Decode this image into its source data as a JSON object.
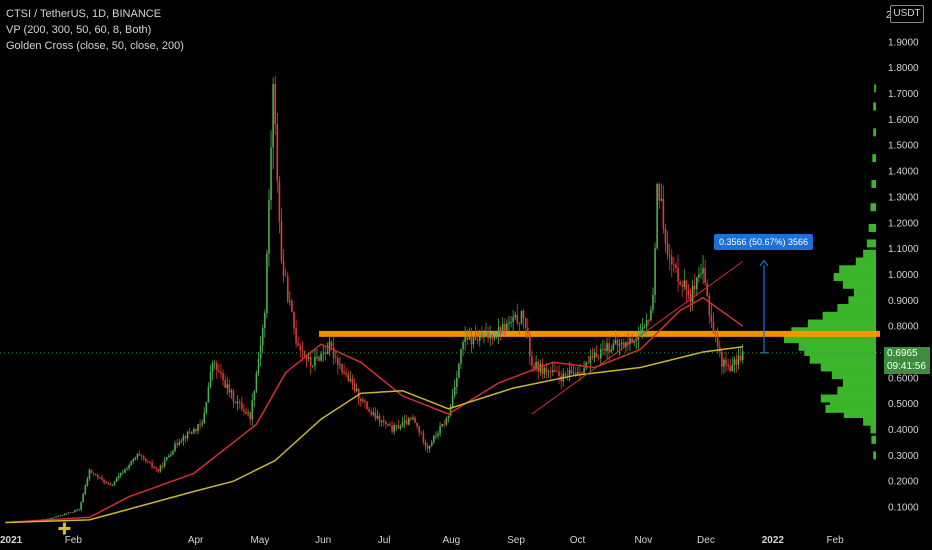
{
  "legend": {
    "title": "CTSI / TetherUS, 1D, BINANCE",
    "vp": "VP (200, 300, 50, 60, 8, Both)",
    "golden_cross": "Golden Cross (close, 50, close, 200)"
  },
  "currency_label": "USDT",
  "scale_top_label": "2",
  "current_price": "0.6965",
  "countdown": "09:41:56",
  "measure_label": "0.3566 (50.67%) 3566",
  "colors": {
    "background": "#000000",
    "candle_up": "#4caf50",
    "candle_down": "#e53935",
    "ma50": "#d32f2f",
    "ma200": "#c8b830",
    "resistance": "#ff9800",
    "volume_profile": "#3bb52b",
    "measure": "#1e6fd9"
  },
  "chart_data": {
    "type": "candlestick",
    "title": "CTSI / TetherUS, 1D, BINANCE",
    "xlabel": "",
    "ylabel": "",
    "y_axis": {
      "ticks": [
        "0.1000",
        "0.2000",
        "0.3000",
        "0.4000",
        "0.5000",
        "0.6000",
        "0.7000",
        "0.8000",
        "0.9000",
        "1.0000",
        "1.1000",
        "1.2000",
        "1.3000",
        "1.4000",
        "1.5000",
        "1.6000",
        "1.7000",
        "1.8000",
        "1.9000"
      ],
      "ylim": [
        0.04,
        2.0
      ],
      "unit": "USDT"
    },
    "x_axis": {
      "ticks": [
        "2021",
        "Feb",
        "Apr",
        "May",
        "Jun",
        "Jul",
        "Aug",
        "Sep",
        "Oct",
        "Nov",
        "Dec",
        "2022",
        "Feb"
      ],
      "bold_ticks": [
        "2021",
        "2022"
      ]
    },
    "price_path": [
      [
        "2021-01-01",
        0.04
      ],
      [
        "2021-01-20",
        0.05
      ],
      [
        "2021-02-05",
        0.09
      ],
      [
        "2021-02-10",
        0.24
      ],
      [
        "2021-02-20",
        0.18
      ],
      [
        "2021-03-05",
        0.3
      ],
      [
        "2021-03-15",
        0.24
      ],
      [
        "2021-03-25",
        0.36
      ],
      [
        "2021-04-05",
        0.42
      ],
      [
        "2021-04-10",
        0.66
      ],
      [
        "2021-04-20",
        0.52
      ],
      [
        "2021-04-28",
        0.45
      ],
      [
        "2021-05-05",
        0.85
      ],
      [
        "2021-05-09",
        1.72
      ],
      [
        "2021-05-13",
        1.05
      ],
      [
        "2021-05-20",
        0.75
      ],
      [
        "2021-05-27",
        0.65
      ],
      [
        "2021-06-05",
        0.72
      ],
      [
        "2021-06-15",
        0.58
      ],
      [
        "2021-06-25",
        0.46
      ],
      [
        "2021-07-05",
        0.4
      ],
      [
        "2021-07-15",
        0.44
      ],
      [
        "2021-07-22",
        0.33
      ],
      [
        "2021-08-01",
        0.45
      ],
      [
        "2021-08-08",
        0.74
      ],
      [
        "2021-08-20",
        0.76
      ],
      [
        "2021-09-06",
        0.84
      ],
      [
        "2021-09-10",
        0.65
      ],
      [
        "2021-09-25",
        0.6
      ],
      [
        "2021-10-05",
        0.64
      ],
      [
        "2021-10-15",
        0.72
      ],
      [
        "2021-10-25",
        0.73
      ],
      [
        "2021-11-03",
        0.78
      ],
      [
        "2021-11-07",
        0.9
      ],
      [
        "2021-11-09",
        1.36
      ],
      [
        "2021-11-15",
        1.05
      ],
      [
        "2021-11-25",
        0.92
      ],
      [
        "2021-12-01",
        1.0
      ],
      [
        "2021-12-05",
        0.82
      ],
      [
        "2021-12-10",
        0.66
      ],
      [
        "2021-12-15",
        0.64
      ],
      [
        "2021-12-20",
        0.7
      ]
    ],
    "series": [
      {
        "name": "",
        "type": "line",
        "values": [
          [
            "2021-01-01",
            0.04
          ],
          [
            "2021-02-10",
            0.06
          ],
          [
            "2021-03-01",
            0.14
          ],
          [
            "2021-04-01",
            0.23
          ],
          [
            "2021-05-01",
            0.42
          ],
          [
            "2021-05-15",
            0.62
          ],
          [
            "2021-06-01",
            0.73
          ],
          [
            "2021-06-20",
            0.66
          ],
          [
            "2021-07-10",
            0.53
          ],
          [
            "2021-08-01",
            0.46
          ],
          [
            "2021-08-25",
            0.58
          ],
          [
            "2021-09-20",
            0.66
          ],
          [
            "2021-10-10",
            0.64
          ],
          [
            "2021-11-01",
            0.71
          ],
          [
            "2021-11-20",
            0.86
          ],
          [
            "2021-12-01",
            0.91
          ],
          [
            "2021-12-20",
            0.8
          ]
        ]
      },
      {
        "name": "",
        "type": "line",
        "values": [
          [
            "2021-01-01",
            0.04
          ],
          [
            "2021-02-10",
            0.05
          ],
          [
            "2021-04-01",
            0.16
          ],
          [
            "2021-04-20",
            0.2
          ],
          [
            "2021-05-10",
            0.28
          ],
          [
            "2021-06-01",
            0.44
          ],
          [
            "2021-06-20",
            0.54
          ],
          [
            "2021-07-10",
            0.55
          ],
          [
            "2021-08-01",
            0.48
          ],
          [
            "2021-09-01",
            0.56
          ],
          [
            "2021-10-01",
            0.61
          ],
          [
            "2021-11-01",
            0.64
          ],
          [
            "2021-12-01",
            0.7
          ],
          [
            "2021-12-20",
            0.72
          ]
        ]
      }
    ],
    "annotations": [
      {
        "type": "horizontal_zone",
        "y": 0.77,
        "from": "2021-05-31",
        "to": "2022-03-31"
      },
      {
        "type": "trendline",
        "from": [
          "2021-09-10",
          0.46
        ],
        "to": [
          "2021-12-20",
          1.05
        ]
      },
      {
        "type": "measure",
        "from_y": 0.6965,
        "to_y": 1.0531,
        "text": "0.3566 (50.67%) 3566"
      },
      {
        "type": "marker",
        "label": "golden-cross",
        "at": [
          "2021-01-29",
          0.04
        ]
      }
    ],
    "volume_profile": [
      [
        0.3,
        0.03
      ],
      [
        0.36,
        0.05
      ],
      [
        0.4,
        0.06
      ],
      [
        0.43,
        0.14
      ],
      [
        0.46,
        0.35
      ],
      [
        0.48,
        0.55
      ],
      [
        0.5,
        0.5
      ],
      [
        0.52,
        0.6
      ],
      [
        0.55,
        0.42
      ],
      [
        0.58,
        0.36
      ],
      [
        0.61,
        0.48
      ],
      [
        0.64,
        0.6
      ],
      [
        0.67,
        0.72
      ],
      [
        0.7,
        0.78
      ],
      [
        0.72,
        0.84
      ],
      [
        0.75,
        1.0
      ],
      [
        0.78,
        0.92
      ],
      [
        0.81,
        0.74
      ],
      [
        0.84,
        0.58
      ],
      [
        0.87,
        0.42
      ],
      [
        0.9,
        0.3
      ],
      [
        0.93,
        0.24
      ],
      [
        0.96,
        0.36
      ],
      [
        0.99,
        0.46
      ],
      [
        1.02,
        0.4
      ],
      [
        1.05,
        0.22
      ],
      [
        1.08,
        0.14
      ],
      [
        1.12,
        0.1
      ],
      [
        1.18,
        0.08
      ],
      [
        1.26,
        0.06
      ],
      [
        1.35,
        0.05
      ],
      [
        1.45,
        0.04
      ],
      [
        1.55,
        0.03
      ],
      [
        1.65,
        0.03
      ],
      [
        1.72,
        0.02
      ]
    ],
    "grid": false,
    "legend_position": "top-left"
  }
}
